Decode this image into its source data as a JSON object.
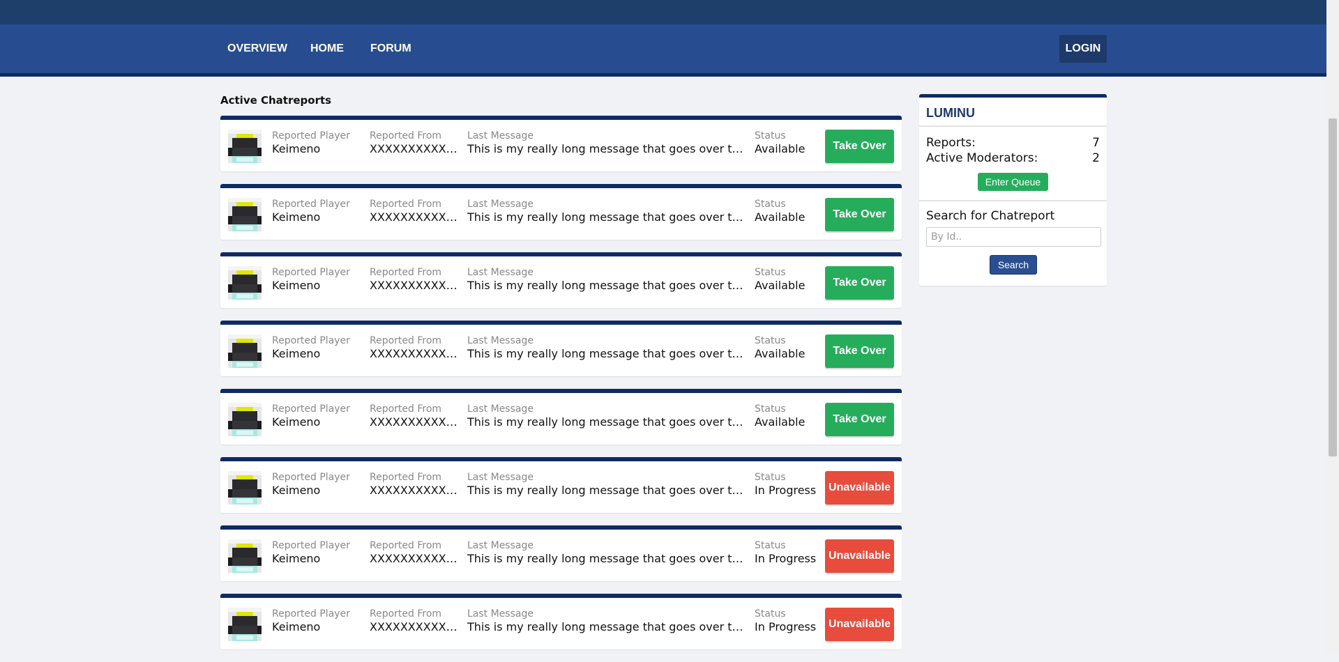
{
  "nav": {
    "items": [
      {
        "label": "OVERVIEW"
      },
      {
        "label": "HOME"
      },
      {
        "label": "FORUM"
      }
    ],
    "login_label": "LOGIN"
  },
  "main": {
    "title": "Active Chatreports",
    "column_labels": {
      "player": "Reported Player",
      "from": "Reported From",
      "message": "Last Message",
      "status": "Status"
    },
    "reports": [
      {
        "player": "Keimeno",
        "from": "XXXXXXXXXXXX...",
        "message": "This is my really long message that goes over the b...",
        "status": "Available",
        "action": "Take Over",
        "state": "available"
      },
      {
        "player": "Keimeno",
        "from": "XXXXXXXXXXXX...",
        "message": "This is my really long message that goes over the b...",
        "status": "Available",
        "action": "Take Over",
        "state": "available"
      },
      {
        "player": "Keimeno",
        "from": "XXXXXXXXXXXX...",
        "message": "This is my really long message that goes over the b...",
        "status": "Available",
        "action": "Take Over",
        "state": "available"
      },
      {
        "player": "Keimeno",
        "from": "XXXXXXXXXXXX...",
        "message": "This is my really long message that goes over the b...",
        "status": "Available",
        "action": "Take Over",
        "state": "available"
      },
      {
        "player": "Keimeno",
        "from": "XXXXXXXXXXXX...",
        "message": "This is my really long message that goes over the b...",
        "status": "Available",
        "action": "Take Over",
        "state": "available"
      },
      {
        "player": "Keimeno",
        "from": "XXXXXXXXXXXX...",
        "message": "This is my really long message that goes over the b...",
        "status": "In Progress",
        "action": "Unavailable",
        "state": "unavailable"
      },
      {
        "player": "Keimeno",
        "from": "XXXXXXXXXXXX...",
        "message": "This is my really long message that goes over the b...",
        "status": "In Progress",
        "action": "Unavailable",
        "state": "unavailable"
      },
      {
        "player": "Keimeno",
        "from": "XXXXXXXXXXXX...",
        "message": "This is my really long message that goes over the b...",
        "status": "In Progress",
        "action": "Unavailable",
        "state": "unavailable"
      }
    ]
  },
  "sidebar": {
    "brand": "LUMINU",
    "reports_label": "Reports:",
    "reports_value": "7",
    "moderators_label": "Active Moderators:",
    "moderators_value": "2",
    "enter_queue_label": "Enter Queue",
    "search_title": "Search for Chatreport",
    "search_placeholder": "By Id..",
    "search_button_label": "Search"
  },
  "colors": {
    "top_strip": "#1f3f6b",
    "navbar": "#274d90",
    "accent_dark": "#0f2a66",
    "available": "#26ad5c",
    "unavailable": "#e74c3c",
    "search_button": "#2a4f91"
  }
}
